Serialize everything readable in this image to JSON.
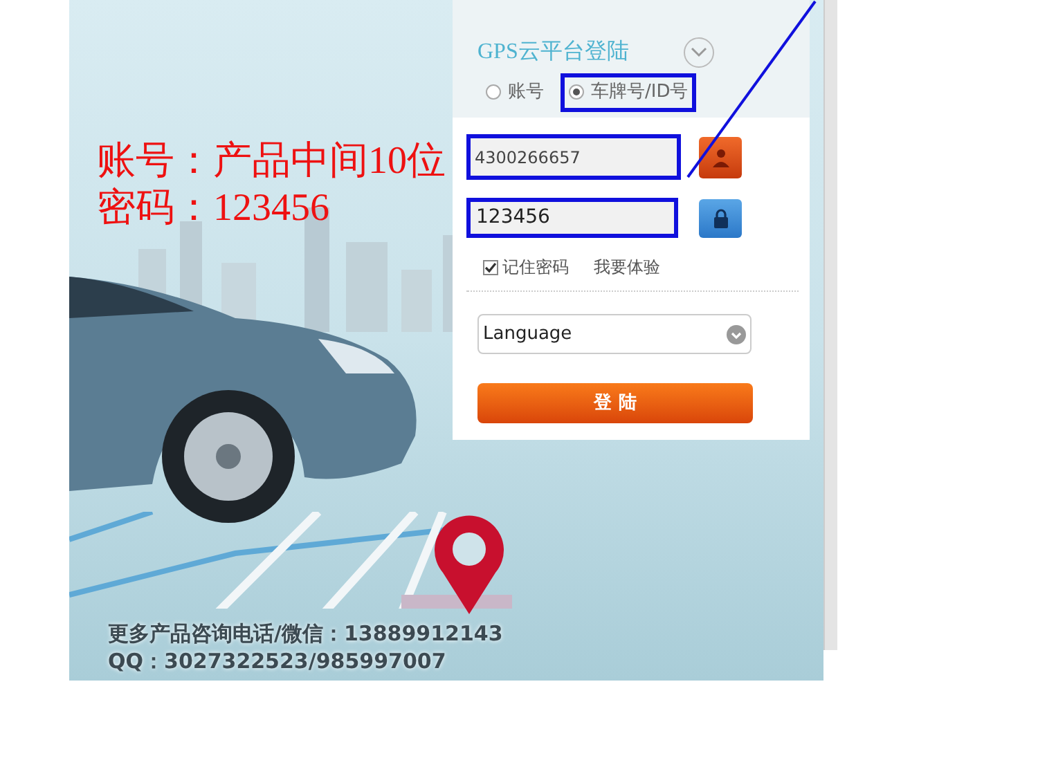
{
  "annotation": {
    "lines": [
      "账号：产品中间10位",
      "密码：123456"
    ]
  },
  "login": {
    "title": "GPS云平台登陆",
    "login_types": [
      {
        "label": "账号",
        "selected": false
      },
      {
        "label": "车牌号/ID号",
        "selected": true
      }
    ],
    "username": {
      "value": "4300266657"
    },
    "password": {
      "value": "123456"
    },
    "remember": {
      "label": "记住密码",
      "checked": true
    },
    "trial_link": "我要体验",
    "language": {
      "value": "Language"
    },
    "submit": "登 陆"
  },
  "contact": [
    "更多产品咨询电话/微信：13889912143",
    "QQ：3027322523/985997007"
  ]
}
